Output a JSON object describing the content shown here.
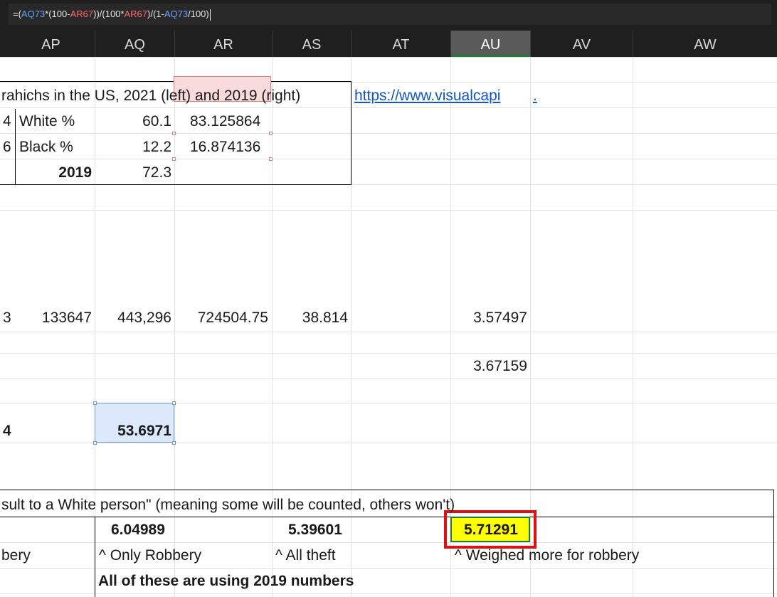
{
  "formula_bar": {
    "prefix": "=(",
    "ref1": "AQ73",
    "mid1": "*(100-",
    "ref2": "AR67",
    "mid2": "))/(100*",
    "ref3": "AR67",
    "mid3": ")/(1-",
    "ref4": "AQ73",
    "suffix": "/100)"
  },
  "columns": [
    "AP",
    "AQ",
    "AR",
    "AS",
    "AT",
    "AU",
    "AV",
    "AW"
  ],
  "selected_column": "AU",
  "cells": {
    "title": "rahichs in the US, 2021 (left) and 2019 (right)",
    "link": "https://www.visualcapi",
    "link_tail": ".",
    "r1_num": "4",
    "r1_label": "White %",
    "r1_aq": "60.1",
    "r1_ar": "83.125864",
    "r2_num": "6",
    "r2_label": "Black %",
    "r2_aq": "12.2",
    "r2_ar": "16.874136",
    "r3_ap": "2019",
    "r3_aq": "72.3",
    "d_left": "3",
    "d_ap": "133647",
    "d_aq": "443,296",
    "d_ar": "724504.75",
    "d_as": "38.814",
    "d_au": "3.57497",
    "e_au": "3.67159",
    "f_left": "4",
    "f_aq": "53.6971",
    "note": "sult to a White person\" (meaning some will be counted, others won't)",
    "v_aq": "6.04989",
    "v_as": "5.39601",
    "v_au": "5.71291",
    "lbl_left": "bery",
    "lbl_aq": "^ Only Robbery",
    "lbl_as": "^ All theft",
    "lbl_au": "^ Weighed more for robbery",
    "footer": "All of these are using 2019 numbers"
  },
  "colors": {
    "highlight_yellow": "#ffff00",
    "annotation_red": "#e01010",
    "pink_selection": "#fadbdb",
    "blue_selection": "#dce8fb",
    "link": "#1155cc"
  }
}
